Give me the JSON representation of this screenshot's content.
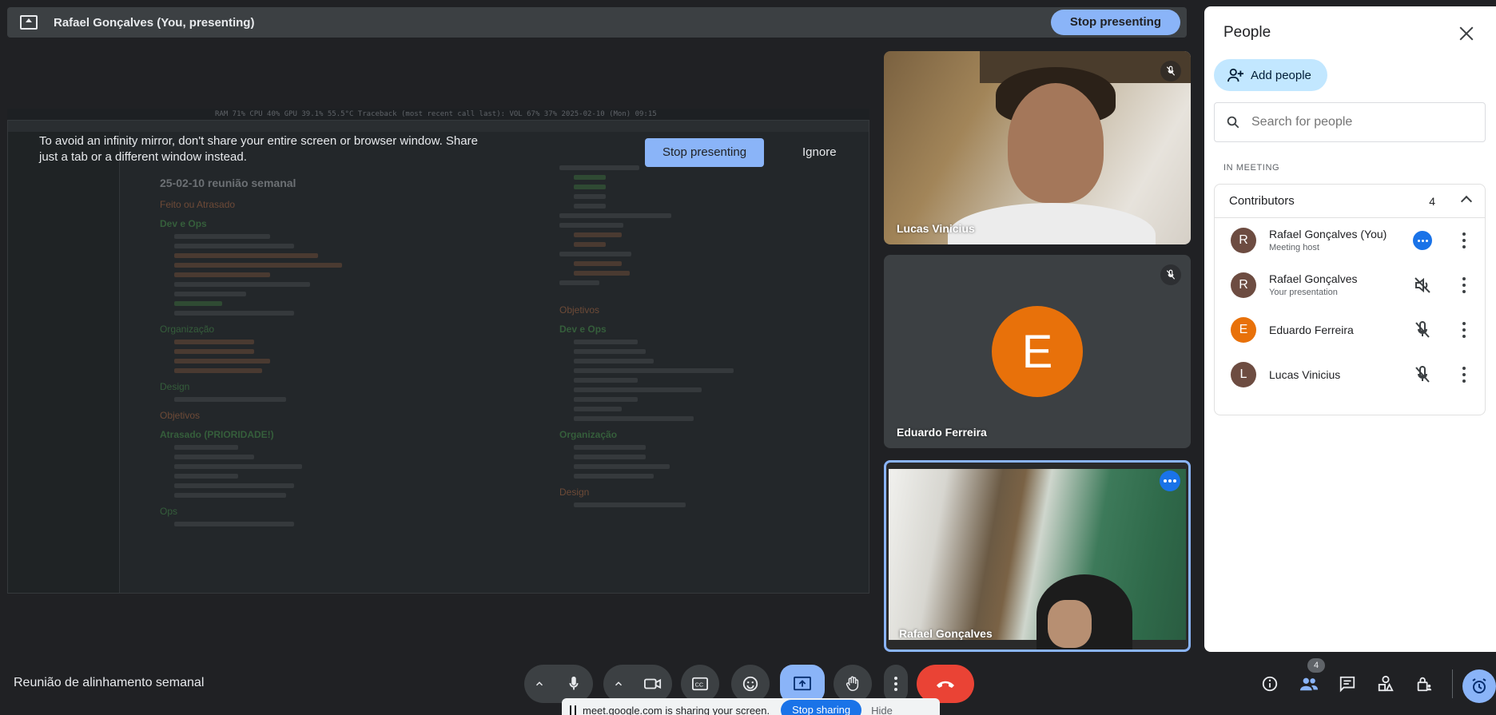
{
  "presenting_bar": {
    "title": "Rafael Gonçalves (You, presenting)",
    "stop_label": "Stop presenting"
  },
  "shared_screen": {
    "status_text": "RAM 71%  CPU 40%  GPU 39.1%  55.5°C  Traceback (most recent call last):  VOL 67%  37%  2025-02-10 (Mon) 09:15",
    "warning_text": "To avoid an infinity mirror, don't share your entire screen or browser window. Share just a tab or a different window instead.",
    "warning_stop_label": "Stop presenting",
    "warning_ignore_label": "Ignore",
    "doc_title": "25-02-10 reunião semanal",
    "left_sections": [
      "Feito ou Atrasado",
      "Dev e Ops",
      "Organização",
      "Design",
      "Objetivos",
      "Atrasado (PRIORIDADE!)",
      "Ops"
    ],
    "right_sections": [
      "Objetivos",
      "Dev e Ops",
      "Organização",
      "Design"
    ]
  },
  "tiles": [
    {
      "name": "Lucas Vinicius",
      "muted": true
    },
    {
      "name": "Eduardo Ferreira",
      "initial": "E",
      "muted": true
    },
    {
      "name": "Rafael Gonçalves",
      "speaking": true
    }
  ],
  "people_panel": {
    "title": "People",
    "add_label": "Add people",
    "search_placeholder": "Search for people",
    "section_label": "IN MEETING",
    "group_label": "Contributors",
    "group_count": "4",
    "people": [
      {
        "initial": "R",
        "name": "Rafael Gonçalves (You)",
        "sub": "Meeting host",
        "color": "#6d4c41"
      },
      {
        "initial": "R",
        "name": "Rafael Gonçalves",
        "sub": "Your presentation",
        "color": "#6d4c41"
      },
      {
        "initial": "E",
        "name": "Eduardo Ferreira",
        "sub": "",
        "color": "#e8710a"
      },
      {
        "initial": "L",
        "name": "Lucas Vinicius",
        "sub": "",
        "color": "#6d4c41"
      }
    ]
  },
  "bottom_bar": {
    "meeting_title": "Reunião de alinhamento semanal",
    "people_count_badge": "4",
    "share_notice_text": "meet.google.com is sharing your screen.",
    "share_notice_stop": "Stop sharing",
    "share_notice_hide": "Hide"
  },
  "colors": {
    "accent": "#8ab4f8",
    "end_call": "#ea4335",
    "background": "#202124",
    "surface": "#3c4043"
  }
}
